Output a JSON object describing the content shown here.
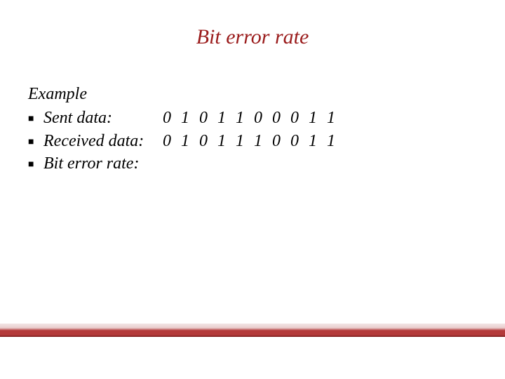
{
  "title": "Bit error rate",
  "body": {
    "heading": "Example",
    "items": [
      {
        "label": "Sent data:",
        "value": "0 1 0 1 1 0 0 0 1 1"
      },
      {
        "label": "Received data:",
        "value": "0 1 0 1 1 1 0 0 1 1"
      },
      {
        "label": "Bit error rate:",
        "value": ""
      }
    ]
  },
  "colors": {
    "accent": "#9a1b1b",
    "band_top": "#f3e8e8",
    "band_mid": "#b43a3a",
    "band_bottom": "#7a1f1f"
  }
}
